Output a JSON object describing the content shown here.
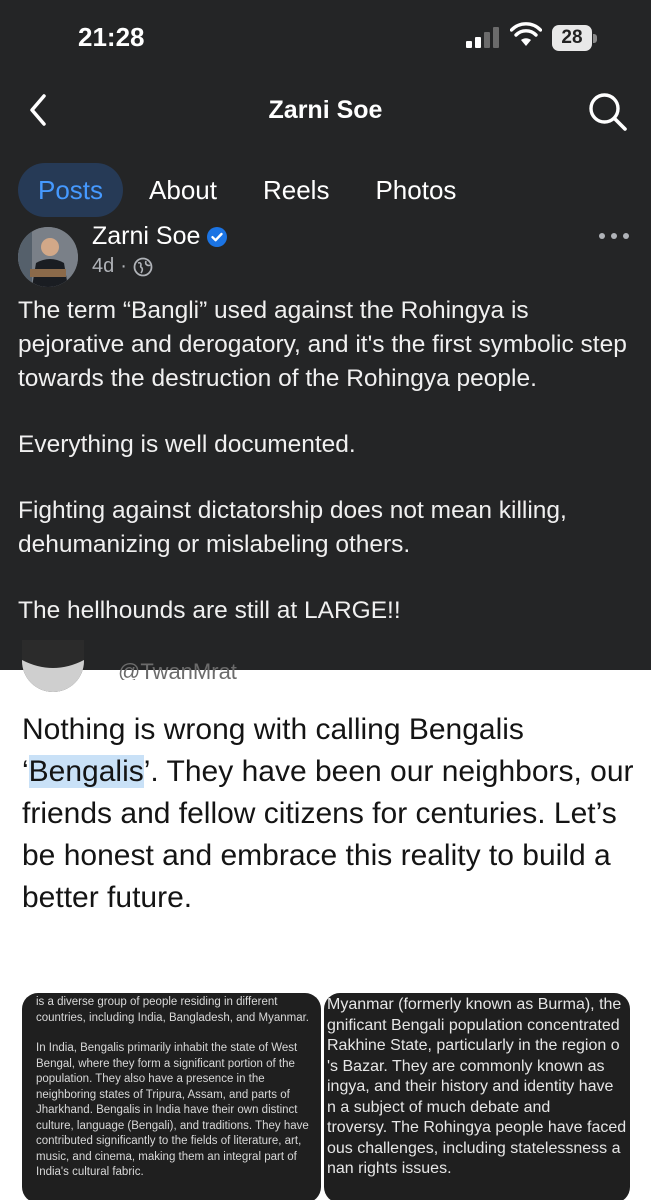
{
  "status_bar": {
    "time": "21:28",
    "battery": "28"
  },
  "header": {
    "title": "Zarni Soe"
  },
  "tabs": [
    {
      "label": "Posts",
      "active": true
    },
    {
      "label": "About",
      "active": false
    },
    {
      "label": "Reels",
      "active": false
    },
    {
      "label": "Photos",
      "active": false
    }
  ],
  "post": {
    "author": "Zarni Soe",
    "time_ago": "4d",
    "separator": "·",
    "paragraphs": [
      "The term “Bangli” used against the Rohingya is pejorative and derogatory, and it's the first symbolic step towards the destruction of the Rohingya people.",
      "Everything is well documented.",
      "Fighting against dictatorship does not mean killing, dehumanizing or mislabeling others.",
      "The hellhounds are still at LARGE!!"
    ]
  },
  "shared_tweet": {
    "handle": "@TwanMrat",
    "text_before": "Nothing is wrong with calling Bengalis ‘",
    "highlighted": "Bengalis",
    "text_after": "’. They have been our neighbors, our friends and fellow citizens for centuries. Let’s be honest and embrace this reality to build a better future."
  },
  "image_left": {
    "paragraphs": [
      "is a diverse group of people residing in different countries, including India, Bangladesh, and Myanmar.",
      "In India, Bengalis primarily inhabit the state of West Bengal, where they form a significant portion of the population. They also have a presence in the neighboring states of Tripura, Assam, and parts of Jharkhand. Bengalis in India have their own distinct culture, language (Bengali), and traditions. They have contributed significantly to the fields of literature, art, music, and cinema, making them an integral part of India's cultural fabric."
    ]
  },
  "image_right": {
    "lines": [
      "Myanmar (formerly known as Burma), the",
      "gnificant Bengali population concentrated",
      "Rakhine State, particularly in the region o",
      "'s Bazar. They are commonly known as",
      "ingya, and their history and identity have",
      "n a subject of much debate and",
      "troversy. The Rohingya people have faced",
      "ous challenges, including statelessness a",
      "nan rights issues."
    ]
  }
}
